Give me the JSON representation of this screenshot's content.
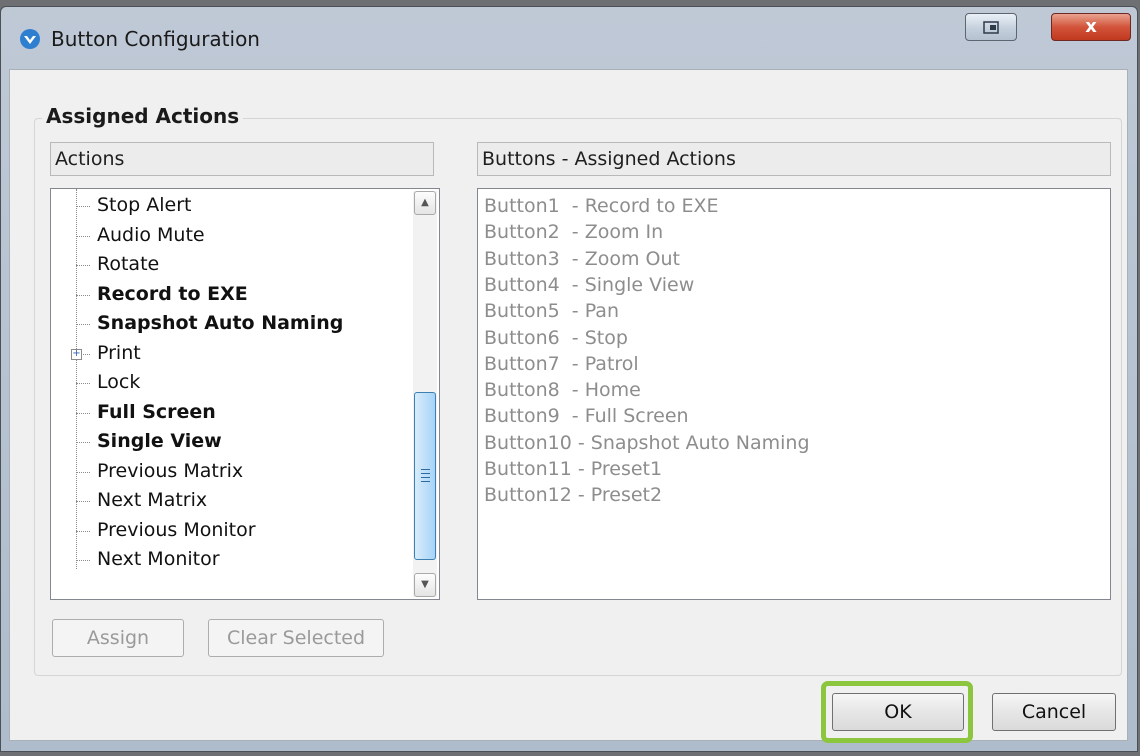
{
  "window": {
    "title": "Button Configuration",
    "close_glyph": "x"
  },
  "group": {
    "label": "Assigned Actions"
  },
  "actions_panel": {
    "header": "Actions",
    "items": [
      {
        "label": "Stop Alert",
        "bold": false
      },
      {
        "label": "Audio Mute",
        "bold": false
      },
      {
        "label": "Rotate",
        "bold": false
      },
      {
        "label": "Record to EXE",
        "bold": true
      },
      {
        "label": "Snapshot Auto Naming",
        "bold": true
      },
      {
        "label": "Print",
        "bold": false,
        "expandable": true
      },
      {
        "label": "Lock",
        "bold": false
      },
      {
        "label": "Full Screen",
        "bold": true
      },
      {
        "label": "Single View",
        "bold": true
      },
      {
        "label": "Previous Matrix",
        "bold": false
      },
      {
        "label": "Next Matrix",
        "bold": false
      },
      {
        "label": "Previous Monitor",
        "bold": false
      },
      {
        "label": "Next Monitor",
        "bold": false
      }
    ]
  },
  "assigned_panel": {
    "header": "Buttons - Assigned Actions",
    "items": [
      "Button1  - Record to EXE",
      "Button2  - Zoom In",
      "Button3  - Zoom Out",
      "Button4  - Single View",
      "Button5  - Pan",
      "Button6  - Stop",
      "Button7  - Patrol",
      "Button8  - Home",
      "Button9  - Full Screen",
      "Button10 - Snapshot Auto Naming",
      "Button11 - Preset1",
      "Button12 - Preset2"
    ]
  },
  "buttons": {
    "assign": "Assign",
    "clear_selected": "Clear Selected",
    "ok": "OK",
    "cancel": "Cancel"
  },
  "colors": {
    "highlight": "#8cc63f",
    "disabled_text": "#9a9a9a"
  },
  "icons": {
    "app": "app-logo-icon",
    "restore": "restore-window-icon",
    "close": "close-icon",
    "scroll_up": "scroll-up-arrow-icon",
    "scroll_down": "scroll-down-arrow-icon",
    "expand": "plus-expand-icon"
  }
}
